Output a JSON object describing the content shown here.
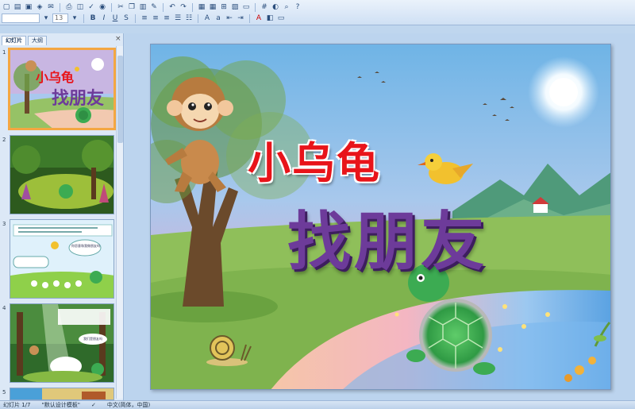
{
  "toolbar": {
    "font_value": "",
    "size_value": "13"
  },
  "panel": {
    "tab_slides": "幻灯片",
    "tab_outline": "大纲",
    "close_glyph": "×",
    "slide_numbers": [
      "1",
      "2",
      "3",
      "4",
      "5"
    ],
    "thumb3_bubble_text": "你愿意和我做朋友吗",
    "thumb4_bubble_text": "我们是朋友吗"
  },
  "slide": {
    "title_line1": "小乌龟",
    "title_line2": "找朋友"
  },
  "status": {
    "slide_position": "幻灯片 1/7",
    "template": "\"默认设计模板\"",
    "language": "中文(简体，中国)"
  },
  "colors": {
    "title_red": "#e8141a",
    "title_purple": "#6d3b9a",
    "selected_border": "#f4a742"
  }
}
